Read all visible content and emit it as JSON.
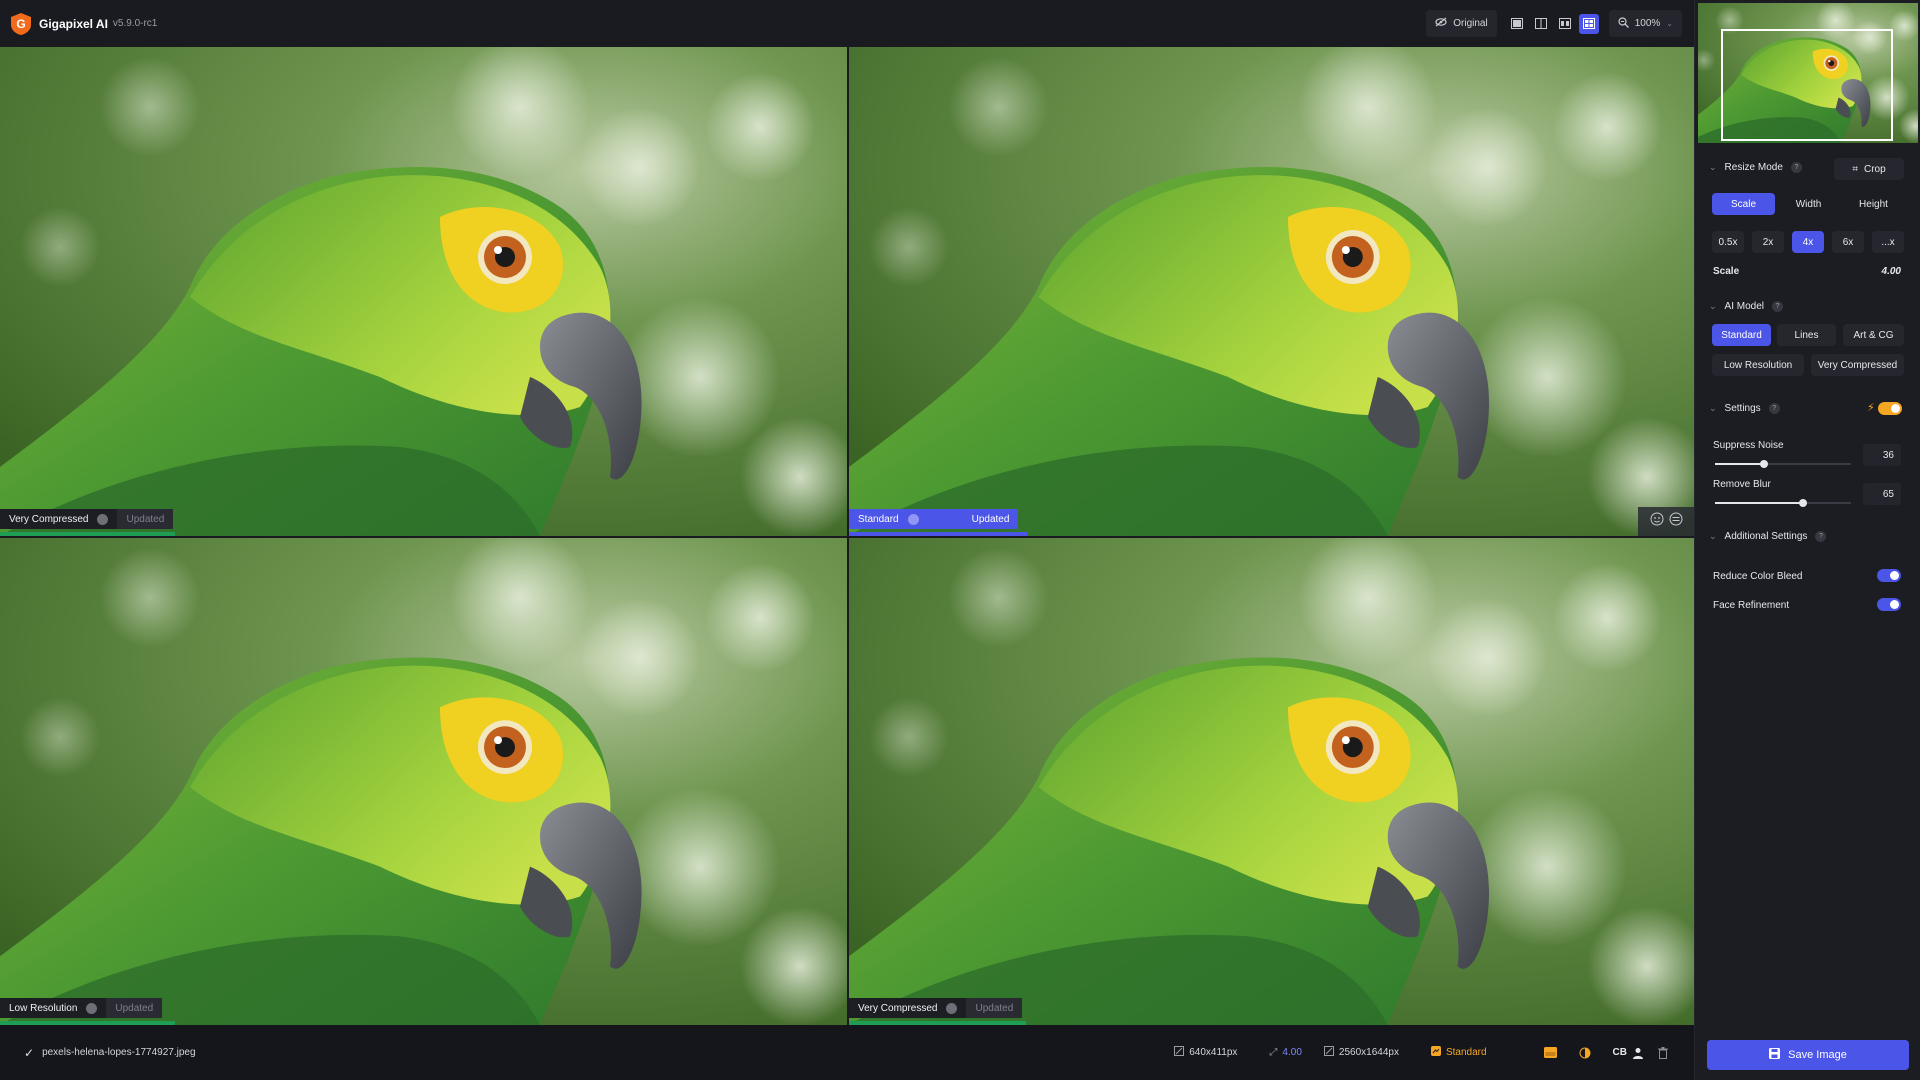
{
  "app": {
    "title": "Gigapixel AI",
    "version": "v5.9.0-rc1"
  },
  "toolbar": {
    "original_label": "Original",
    "view_icons": [
      "single-view-icon",
      "split-view-icon",
      "side-by-side-view-icon",
      "quad-view-icon"
    ],
    "active_view": 3,
    "zoom_label": "100%"
  },
  "panes": [
    {
      "model": "Very Compressed",
      "status": "Updated",
      "active": false
    },
    {
      "model": "Standard",
      "status": "Updated",
      "active": true
    },
    {
      "model": "Low Resolution",
      "status": "Updated",
      "active": false
    },
    {
      "model": "Very Compressed",
      "status": "Updated",
      "active": false
    }
  ],
  "bottombar": {
    "file_name": "pexels-helena-lopes-1774927.jpeg",
    "input_size": "640x411px",
    "scale": "4.00",
    "output_size": "2560x1644px",
    "model": "Standard",
    "cb_label": "CB"
  },
  "panel": {
    "resize_mode": {
      "title": "Resize Mode",
      "crop_label": "Crop",
      "tabs": [
        "Scale",
        "Width",
        "Height"
      ],
      "active_tab": 0,
      "presets": [
        "0.5x",
        "2x",
        "4x",
        "6x",
        "...x"
      ],
      "active_preset": 2,
      "scale_label": "Scale",
      "scale_value": "4.00"
    },
    "ai_model": {
      "title": "AI Model",
      "row1": [
        "Standard",
        "Lines",
        "Art & CG"
      ],
      "row2": [
        "Low Resolution",
        "Very Compressed"
      ],
      "active": "Standard"
    },
    "settings": {
      "title": "Settings",
      "suppress_noise_label": "Suppress Noise",
      "suppress_noise_value": "36",
      "suppress_noise_fraction": 0.36,
      "remove_blur_label": "Remove Blur",
      "remove_blur_value": "65",
      "remove_blur_fraction": 0.65
    },
    "additional": {
      "title": "Additional Settings",
      "reduce_color_bleed_label": "Reduce Color Bleed",
      "reduce_color_bleed_on": true,
      "face_refinement_label": "Face Refinement",
      "face_refinement_on": true
    },
    "save_label": "Save Image"
  },
  "colors": {
    "accent": "#4b55e8",
    "updated_bar": "#1f9d55",
    "model_orange": "#f5a623"
  }
}
